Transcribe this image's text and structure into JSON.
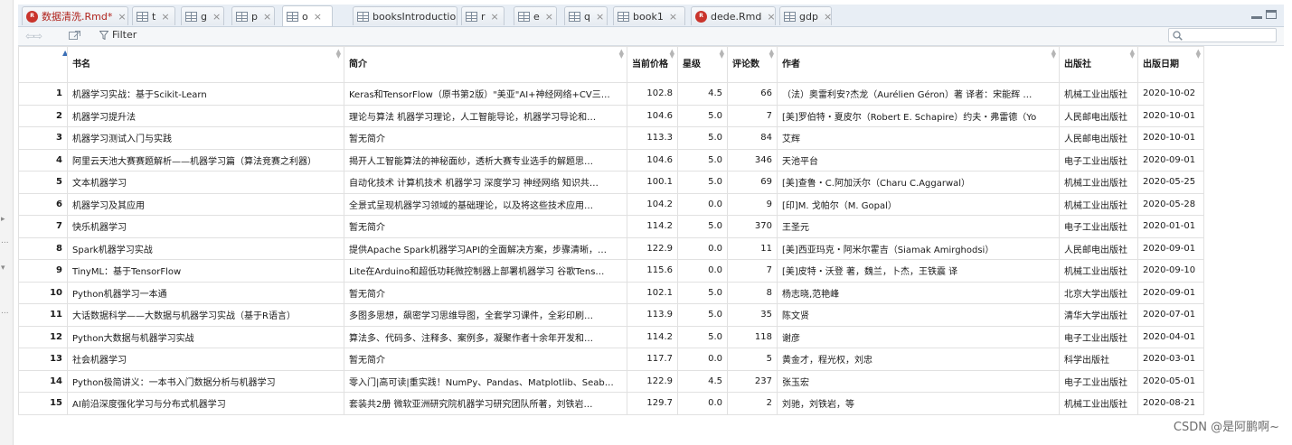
{
  "tabs": [
    {
      "label": "数据清洗.Rmd*",
      "icon": "rmd-icon",
      "active": false,
      "unsaved": true
    },
    {
      "label": "t",
      "icon": "grid-icon",
      "active": false
    },
    {
      "label": "g",
      "icon": "grid-icon",
      "active": false
    },
    {
      "label": "p",
      "icon": "grid-icon",
      "active": false
    },
    {
      "label": "o",
      "icon": "grid-icon",
      "active": true
    },
    {
      "label": "booksIntroduction",
      "icon": "grid-icon",
      "active": false
    },
    {
      "label": "r",
      "icon": "grid-icon",
      "active": false
    },
    {
      "label": "e",
      "icon": "grid-icon",
      "active": false
    },
    {
      "label": "q",
      "icon": "grid-icon",
      "active": false
    },
    {
      "label": "book1",
      "icon": "grid-icon",
      "active": false
    },
    {
      "label": "dede.Rmd",
      "icon": "rmd-icon",
      "active": false
    },
    {
      "label": "gdp",
      "icon": "grid-icon",
      "active": false
    }
  ],
  "rmd_icon_text": "R",
  "close_glyph": "×",
  "toolbar": {
    "filter_label": "Filter",
    "search_placeholder": ""
  },
  "table": {
    "columns": [
      "",
      "书名",
      "简介",
      "当前价格",
      "星级",
      "评论数",
      "作者",
      "出版社",
      "出版日期"
    ],
    "rows": [
      [
        "1",
        "机器学习实战：基于Scikit-Learn",
        "Keras和TensorFlow（原书第2版）\"美亚\"AI+神经网络+CV三…",
        "102.8",
        "4.5",
        "66",
        "（法）奥雷利安?杰龙（Aurélien Géron）著 译者：宋能辉 …",
        "机械工业出版社",
        "2020-10-02"
      ],
      [
        "2",
        "机器学习提升法",
        "理论与算法 机器学习理论，人工智能导论，机器学习导论和…",
        "104.6",
        "5.0",
        "7",
        "[美]罗伯特・夏皮尔（Robert E. Schapire）约夫・弗雷德（Yo",
        "人民邮电出版社",
        "2020-10-01"
      ],
      [
        "3",
        "机器学习测试入门与实践",
        "暂无简介",
        "113.3",
        "5.0",
        "84",
        "艾辉",
        "人民邮电出版社",
        "2020-10-01"
      ],
      [
        "4",
        "阿里云天池大赛赛题解析——机器学习篇（算法竞赛之利器）",
        "揭开人工智能算法的神秘面纱，透析大赛专业选手的解题思…",
        "104.6",
        "5.0",
        "346",
        "天池平台",
        "电子工业出版社",
        "2020-09-01"
      ],
      [
        "5",
        "文本机器学习",
        "自动化技术 计算机技术 机器学习 深度学习 神经网络 知识共…",
        "100.1",
        "5.0",
        "69",
        "[美]查鲁・C.阿加沃尔（Charu C.Aggarwal）",
        "机械工业出版社",
        "2020-05-25"
      ],
      [
        "6",
        "机器学习及其应用",
        "全景式呈现机器学习领域的基础理论，以及将这些技术应用…",
        "104.2",
        "0.0",
        "9",
        "[印]M. 戈帕尔（M. Gopal）",
        "机械工业出版社",
        "2020-05-28"
      ],
      [
        "7",
        "快乐机器学习",
        "暂无简介",
        "114.2",
        "5.0",
        "370",
        "王圣元",
        "电子工业出版社",
        "2020-01-01"
      ],
      [
        "8",
        "Spark机器学习实战",
        "提供Apache Spark机器学习API的全面解决方案，步骤清晰，…",
        "122.9",
        "0.0",
        "11",
        "[美]西亚玛克・阿米尔霍吉（Siamak Amirghodsi）",
        "人民邮电出版社",
        "2020-09-01"
      ],
      [
        "9",
        "TinyML：基于TensorFlow",
        "Lite在Arduino和超低功耗微控制器上部署机器学习 谷歌Tens…",
        "115.6",
        "0.0",
        "7",
        "[美]皮特・沃登 著，魏兰，卜杰，王铁震 译",
        "机械工业出版社",
        "2020-09-10"
      ],
      [
        "10",
        "Python机器学习一本通",
        "暂无简介",
        "102.1",
        "5.0",
        "8",
        "杨志晓,范艳峰",
        "北京大学出版社",
        "2020-09-01"
      ],
      [
        "11",
        "大话数据科学——大数据与机器学习实战（基于R语言）",
        "多图多思想，飙密学习思维导图，全套学习课件，全彩印刷…",
        "113.9",
        "5.0",
        "35",
        "陈文贤",
        "清华大学出版社",
        "2020-07-01"
      ],
      [
        "12",
        "Python大数据与机器学习实战",
        "算法多、代码多、注释多、案例多，凝聚作者十余年开发和…",
        "114.2",
        "5.0",
        "118",
        "谢彦",
        "电子工业出版社",
        "2020-04-01"
      ],
      [
        "13",
        "社会机器学习",
        "暂无简介",
        "117.7",
        "0.0",
        "5",
        "黄金才，程光权，刘忠",
        "科学出版社",
        "2020-03-01"
      ],
      [
        "14",
        "Python极简讲义：一本书入门数据分析与机器学习",
        "零入门|高可读|重实践！NumPy、Pandas、Matplotlib、Seab…",
        "122.9",
        "4.5",
        "237",
        "张玉宏",
        "电子工业出版社",
        "2020-05-01"
      ],
      [
        "15",
        "AI前沿深度强化学习与分布式机器学习",
        "套装共2册 微软亚洲研究院机器学习研究团队所著，刘铁岩…",
        "129.7",
        "0.0",
        "2",
        "刘驰，刘铁岩，等",
        "机械工业出版社",
        "2020-08-21"
      ]
    ]
  },
  "watermark": "CSDN @是阿鹏啊~",
  "left_strip_marks": [
    "▸",
    "...",
    "▾",
    "..."
  ],
  "colors": {
    "unsaved_tab": "#b0231c",
    "rmd_icon": "#c9342c",
    "sort_active": "#3b6fb6"
  }
}
